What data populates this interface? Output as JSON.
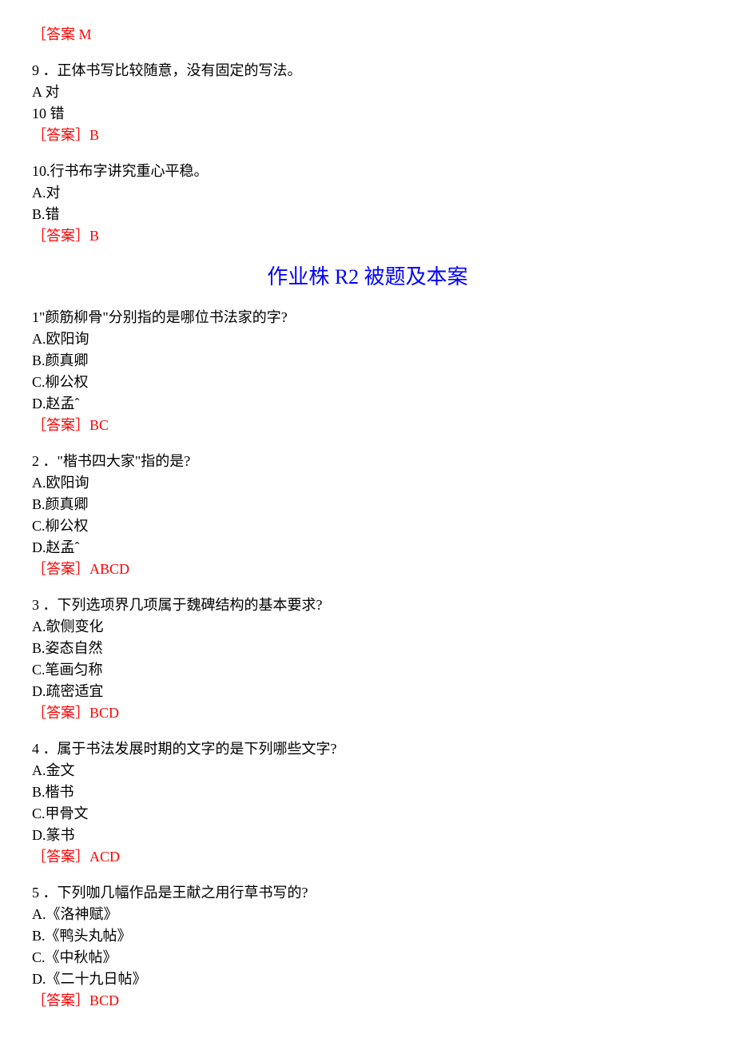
{
  "top_answer": "［答案 M",
  "q9": {
    "stem": "9 ．正体书写比较随意，没有固定的写法。",
    "optA": "A 对",
    "optB": "10 错",
    "answer": "［答案］B"
  },
  "q10": {
    "stem": "10.行书布字讲究重心平稳。",
    "optA": "A.对",
    "optB": "B.错",
    "answer": "［答案］B"
  },
  "section_title": "作业株 R2 被题及本案",
  "mq1": {
    "stem": "1\"颜筋柳骨\"分别指的是哪位书法家的字?",
    "optA": "A.欧阳询",
    "optB": "B.颜真卿",
    "optC": "C.柳公权",
    "optD": "D.赵孟ˆ",
    "answer": "［答案］BC"
  },
  "mq2": {
    "stem": "2 ．\"楷书四大家\"指的是?",
    "optA": "A.欧阳询",
    "optB": "B.颜真卿",
    "optC": "C.柳公权",
    "optD": "D.赵孟ˆ",
    "answer": "［答案］ABCD"
  },
  "mq3": {
    "stem": "3 ．下列选项界几项属于魏碑结构的基本要求?",
    "optA": "A.欹侧变化",
    "optB": "B.姿态自然",
    "optC": "C.笔画匀称",
    "optD": "D.疏密适宜",
    "answer": "［答案］BCD"
  },
  "mq4": {
    "stem": "4 ．属于书法发展时期的文字的是下列哪些文字?",
    "optA": "A.金文",
    "optB": "B.楷书",
    "optC": "C.甲骨文",
    "optD": "D.篆书",
    "answer": "［答案］ACD"
  },
  "mq5": {
    "stem": "5 ．下列咖几幅作品是王献之用行草书写的?",
    "optA": "A.《洛神赋》",
    "optB": "B.《鸭头丸帖》",
    "optC": "C.《中秋帖》",
    "optD": "D.《二十九日帖》",
    "answer": "［答案］BCD"
  }
}
